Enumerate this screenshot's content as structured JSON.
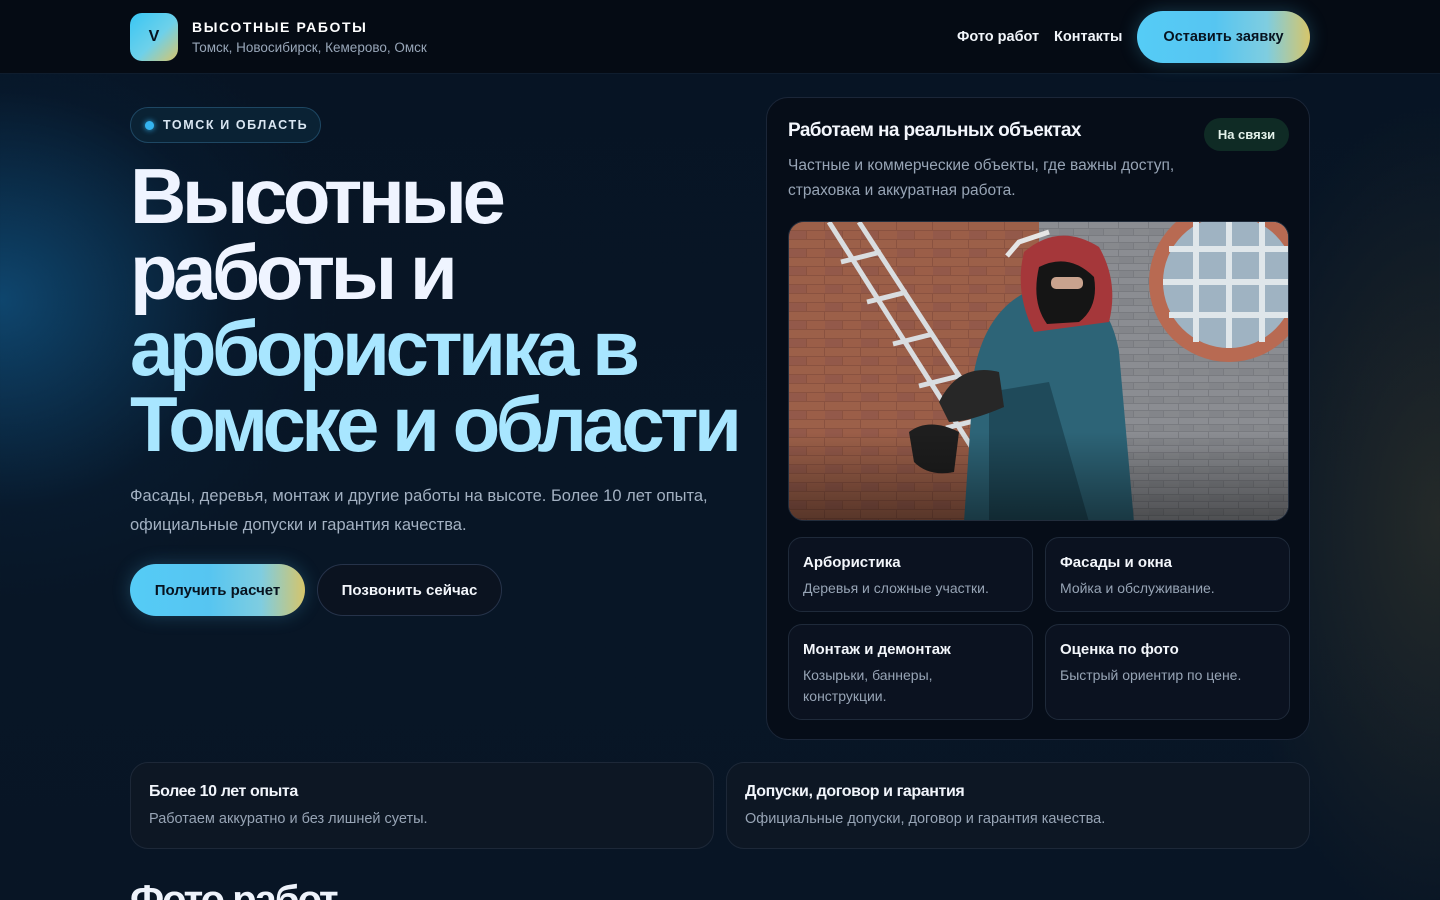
{
  "header": {
    "logo_letter": "V",
    "brand_title": "ВЫСОТНЫЕ РАБОТЫ",
    "brand_sub": "Томск, Новосибирск, Кемерово, Омск",
    "nav": [
      "Фото работ",
      "Контакты"
    ],
    "cta": "Оставить заявку"
  },
  "hero": {
    "chip": "ТОМСК И ОБЛАСТЬ",
    "title_line1": "Высотные",
    "title_line2": "работы и",
    "title_line3": "арбористика в",
    "title_line4": "Томске и области",
    "description": "Фасады, деревья, монтаж и другие работы на высоте. Более 10 лет опыта, официальные допуски и гарантия качества.",
    "primary_button": "Получить расчет",
    "secondary_button": "Позвонить сейчас"
  },
  "panel": {
    "title": "Работаем на реальных объектах",
    "badge": "На связи",
    "description": "Частные и коммерческие объекты, где важны доступ, страховка и аккуратная работа.",
    "services": [
      {
        "title": "Арбористика",
        "desc": "Деревья и сложные участки."
      },
      {
        "title": "Фасады и окна",
        "desc": "Мойка и обслуживание."
      },
      {
        "title": "Монтаж и демонтаж",
        "desc": "Козырьки, баннеры, конструкции."
      },
      {
        "title": "Оценка по фото",
        "desc": "Быстрый ориентир по цене."
      }
    ]
  },
  "features": [
    {
      "title": "Более 10 лет опыта",
      "desc": "Работаем аккуратно и без лишней суеты."
    },
    {
      "title": "Допуски, договор и гарантия",
      "desc": "Официальные допуски, договор и гарантия качества."
    }
  ],
  "section": {
    "title": "Фото работ"
  },
  "colors": {
    "accent": "#55ccf6",
    "accent_end": "#d6c56a",
    "title_highlight": "#a8e6ff",
    "background": "#071424"
  }
}
